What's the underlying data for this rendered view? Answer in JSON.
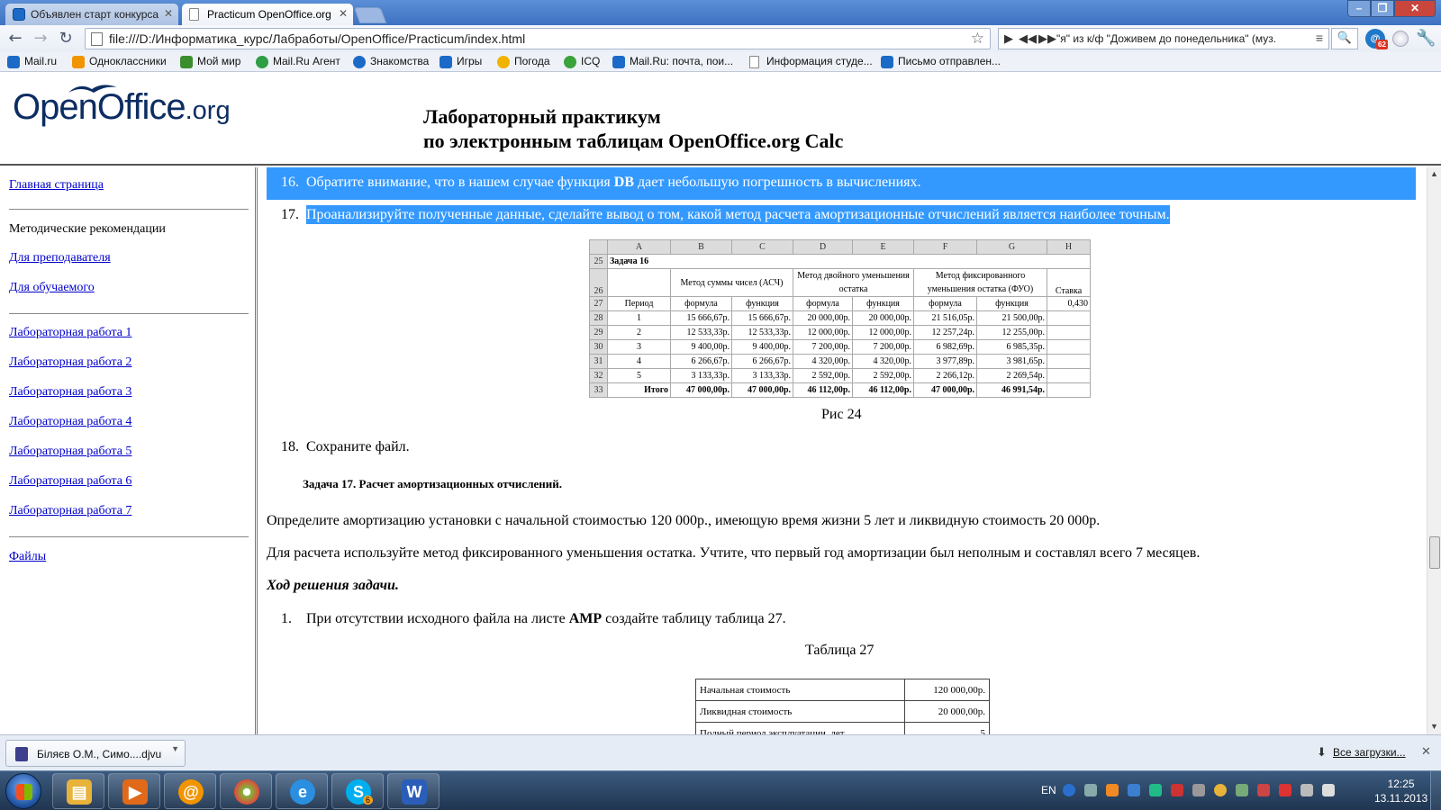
{
  "browser": {
    "tabs": [
      {
        "title": "Объявлен старт конкурса",
        "icon": "mail-ru-icon"
      },
      {
        "title": "Practicum OpenOffice.org",
        "icon": "page-icon"
      }
    ],
    "address": "file:///D:/Информатика_курс/Лабработы/OpenOffice/Practicum/index.html",
    "media_title": "\"я\" из к/ф \"Доживем до понедельника\" (муз.",
    "notification_badge": "62",
    "bookmarks": [
      {
        "label": "Mail.ru",
        "icon": "mail-ru-icon",
        "color": "#1c6ac7"
      },
      {
        "label": "Одноклассники",
        "icon": "odnoklassniki-icon",
        "color": "#f29400"
      },
      {
        "label": "Мой мир",
        "icon": "moy-mir-icon",
        "color": "#3b8e2e"
      },
      {
        "label": "Mail.Ru Агент",
        "icon": "agent-icon",
        "color": "#2f9e44"
      },
      {
        "label": "Знакомства",
        "icon": "at-icon",
        "color": "#1c6ac7"
      },
      {
        "label": "Игры",
        "icon": "games-icon",
        "color": "#1c6ac7"
      },
      {
        "label": "Погода",
        "icon": "weather-icon",
        "color": "#f2b200"
      },
      {
        "label": "ICQ",
        "icon": "icq-icon",
        "color": "#3aa33a"
      },
      {
        "label": "Mail.Ru: почта, пои...",
        "icon": "mail-ru-icon",
        "color": "#1c6ac7"
      },
      {
        "label": "Информация студе...",
        "icon": "page-icon",
        "color": "#ffffff"
      },
      {
        "label": "Письмо отправлен...",
        "icon": "mail-ru-icon",
        "color": "#1c6ac7"
      }
    ]
  },
  "header": {
    "logo_main": "OpenOffice",
    "logo_suffix": ".org",
    "title_line1": "Лабораторный практикум",
    "title_line2": "по электронным таблицам OpenOffice.org Calc"
  },
  "sidebar": {
    "home": "Главная страница",
    "methods": "Методические рекомендации",
    "for_teacher": "Для преподавателя",
    "for_student": "Для обучаемого",
    "labs": [
      "Лабораторная работа 1",
      "Лабораторная работа 2",
      "Лабораторная работа 3",
      "Лабораторная работа 4",
      "Лабораторная работа 5",
      "Лабораторная работа 6",
      "Лабораторная работа 7"
    ],
    "files": "Файлы"
  },
  "content": {
    "step16_num": "16.",
    "step16_pre": "Обратите внимание, что в нашем случае функция ",
    "step16_bold": "DB",
    "step16_post": " дает небольшую погрешность в вычислениях.",
    "step17_num": "17.",
    "step17": "Проанализируйте полученные данные, сделайте вывод о том, какой метод расчета амортизационные отчислений является наиболее точным.",
    "figure_caption": "Рис 24",
    "step18_num": "18.",
    "step18": "Сохраните файл.",
    "task17_title": "Задача 17. Расчет амортизационных отчислений.",
    "para1": "Определите амортизацию установки с начальной стоимостью 120 000р., имеющую время жизни 5 лет и ликвидную стоимость 20 000р.",
    "para2": "Для расчета используйте метод фиксированного уменьшения остатка. Учтите, что первый год амортизации был неполным и составлял всего 7 месяцев.",
    "solution_heading": "Ход решения задачи.",
    "step1_num": "1.",
    "step1_pre": "При отсутствии исходного файла на листе ",
    "step1_bold": "АМР",
    "step1_post": " создайте таблицу таблица 27.",
    "table27_caption": "Таблица 27",
    "table27_rows": [
      {
        "key": "Начальная стоимость",
        "value": "120 000,00р."
      },
      {
        "key": "Ликвидная стоимость",
        "value": "20 000,00р."
      },
      {
        "key": "Полный период эксплуатации, лет",
        "value": "5"
      }
    ]
  },
  "sheet": {
    "columns": [
      "",
      "A",
      "B",
      "C",
      "D",
      "E",
      "F",
      "G",
      "H"
    ],
    "r25": {
      "row": "25",
      "title": "Задача 16"
    },
    "r26": {
      "row": "26",
      "asch": "Метод суммы чисел (АСЧ)",
      "double": "Метод двойного уменьшения остатка",
      "fuo": "Метод фиксированного уменьшения остатка (ФУО)",
      "rate": "Ставка"
    },
    "r27": {
      "row": "27",
      "period": "Период",
      "f1": "формула",
      "fn1": "функция",
      "f2": "формула",
      "fn2": "функция",
      "f3": "формула",
      "fn3": "функция",
      "rate": "0,430"
    },
    "rows": [
      {
        "row": "28",
        "cells": [
          "1",
          "15 666,67р.",
          "15 666,67р.",
          "20 000,00р.",
          "20 000,00р.",
          "21 516,05р.",
          "21 500,00р.",
          ""
        ]
      },
      {
        "row": "29",
        "cells": [
          "2",
          "12 533,33р.",
          "12 533,33р.",
          "12 000,00р.",
          "12 000,00р.",
          "12 257,24р.",
          "12 255,00р.",
          ""
        ]
      },
      {
        "row": "30",
        "cells": [
          "3",
          "9 400,00р.",
          "9 400,00р.",
          "7 200,00р.",
          "7 200,00р.",
          "6 982,69р.",
          "6 985,35р.",
          ""
        ]
      },
      {
        "row": "31",
        "cells": [
          "4",
          "6 266,67р.",
          "6 266,67р.",
          "4 320,00р.",
          "4 320,00р.",
          "3 977,89р.",
          "3 981,65р.",
          ""
        ]
      },
      {
        "row": "32",
        "cells": [
          "5",
          "3 133,33р.",
          "3 133,33р.",
          "2 592,00р.",
          "2 592,00р.",
          "2 266,12р.",
          "2 269,54р.",
          ""
        ]
      }
    ],
    "total": {
      "row": "33",
      "label": "Итого",
      "cells": [
        "47 000,00р.",
        "47 000,00р.",
        "46 112,00р.",
        "46 112,00р.",
        "47 000,00р.",
        "46 991,54р.",
        ""
      ]
    }
  },
  "downloads": {
    "item": "Біляєв О.М., Симо....djvu",
    "all": "Все загрузки..."
  },
  "taskbar": {
    "apps": [
      {
        "name": "explorer",
        "icon": "folder-icon",
        "color": "#e8b33a"
      },
      {
        "name": "media",
        "icon": "media-player-icon",
        "color": "#e06a1a"
      },
      {
        "name": "mail-agent",
        "icon": "at-icon",
        "color": "#f29400"
      },
      {
        "name": "chrome",
        "icon": "browser-icon",
        "color": "#7fb83a"
      },
      {
        "name": "ie",
        "icon": "internet-explorer-icon",
        "color": "#2a8fe0"
      },
      {
        "name": "skype",
        "icon": "skype-icon",
        "color": "#00aff0"
      },
      {
        "name": "word",
        "icon": "word-icon",
        "color": "#2b5eb8"
      }
    ],
    "lang": "EN",
    "time": "12:25",
    "date": "13.11.2013",
    "skype_badge": "6"
  }
}
